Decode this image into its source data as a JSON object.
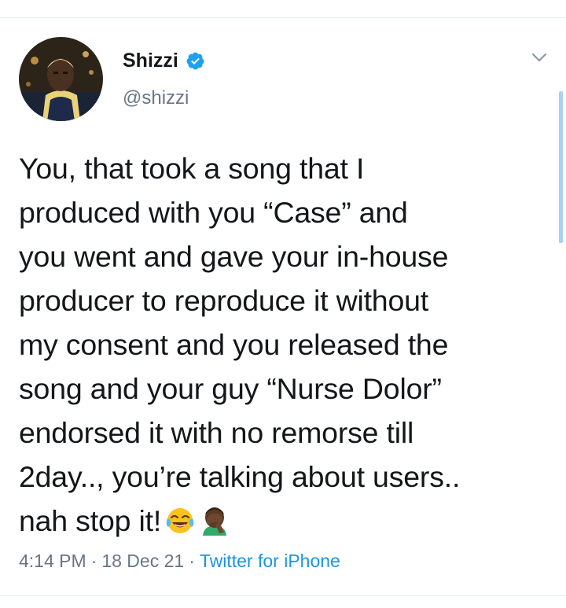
{
  "author": {
    "display_name": "Shizzi",
    "handle": "@shizzi",
    "verified": true
  },
  "icons": {
    "verified": "verified-badge-icon",
    "menu": "chevron-down-icon",
    "emoji_1": "face-with-tears-of-joy-emoji",
    "emoji_2": "person-facepalming-emoji"
  },
  "tweet": {
    "lines": [
      "You, that took a song that I",
      "produced with you “Case” and",
      "you went and gave your in-house",
      "producer to reproduce it without",
      "my consent and you released the",
      "song and your guy “Nurse Dolor”",
      "endorsed it with no remorse till",
      "2day.., you’re talking about users..",
      "nah stop it!"
    ]
  },
  "meta": {
    "time": "4:14 PM",
    "separator": "·",
    "date": "18 Dec 21",
    "source": "Twitter for iPhone"
  },
  "colors": {
    "text": "#14171a",
    "secondary": "#657786",
    "link": "#1b95e0",
    "verified": "#1da1f2"
  }
}
